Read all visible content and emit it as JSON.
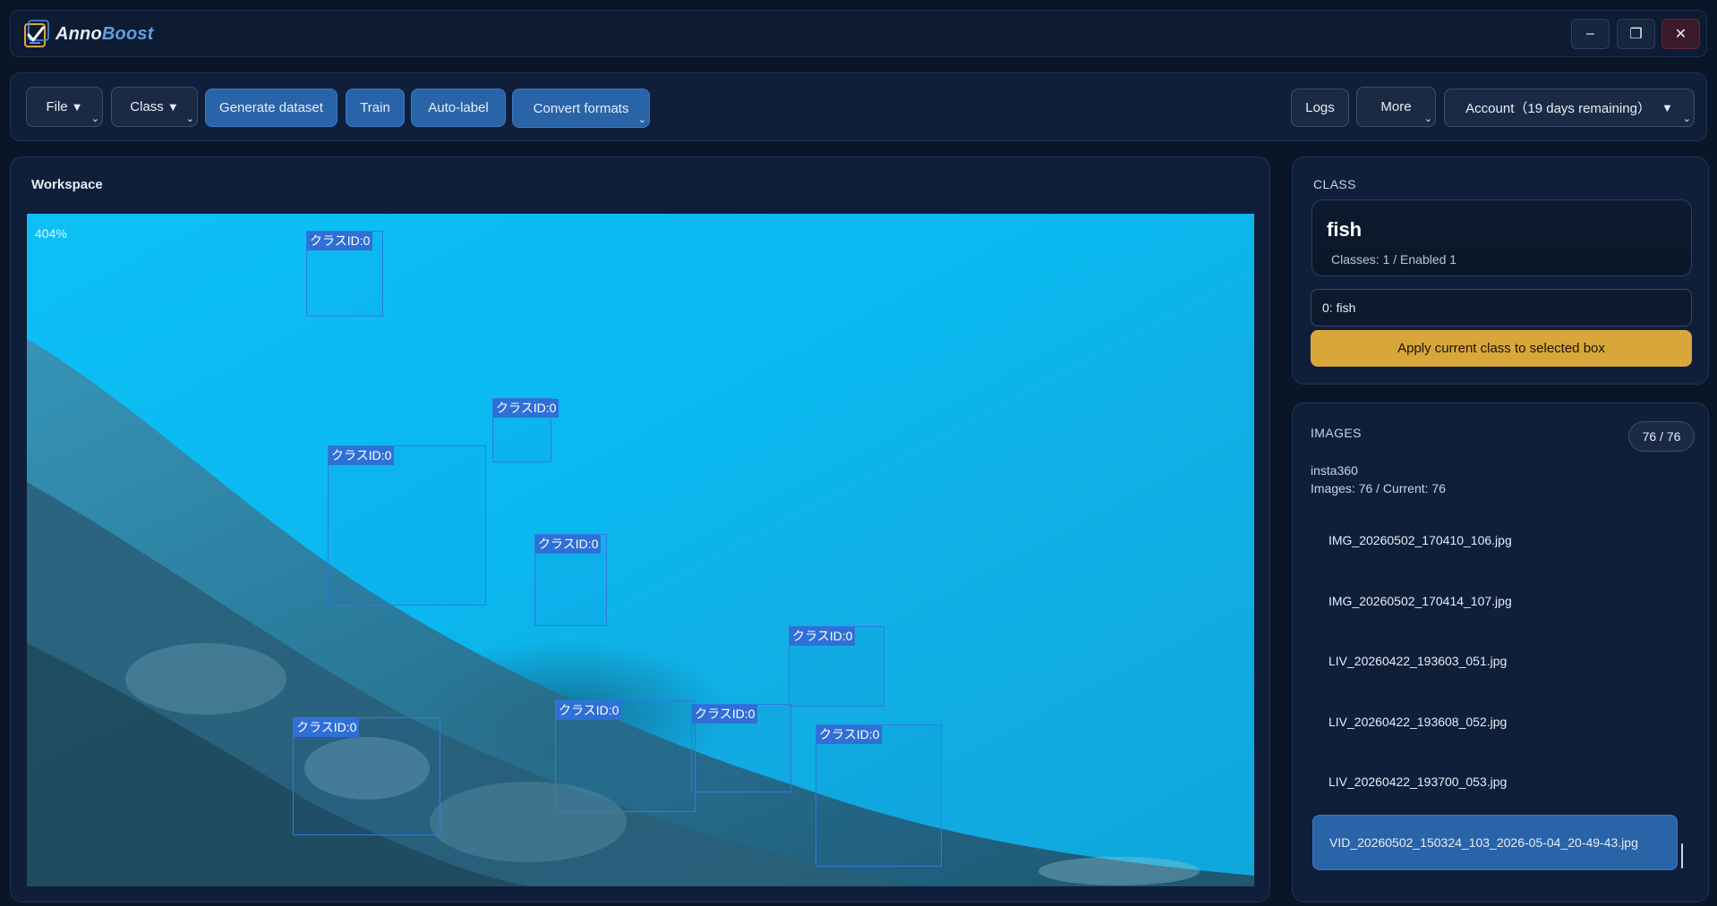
{
  "app": {
    "name_part1": "Anno",
    "name_part2": "Boost",
    "window_controls": {
      "minimize": "–",
      "restore": "❐",
      "close": "✕"
    }
  },
  "toolbar": {
    "file": "File",
    "class": "Class",
    "generate_dataset": "Generate dataset",
    "train": "Train",
    "auto_label": "Auto-label",
    "convert_formats": "Convert formats",
    "logs": "Logs",
    "more": "More",
    "account": "Account（19 days remaining）",
    "caret": "▼",
    "chevron": "⌄"
  },
  "workspace": {
    "title": "Workspace",
    "zoom": "404%",
    "boxes": [
      {
        "label": "クラスID:0"
      },
      {
        "label": "クラスID:0"
      },
      {
        "label": "クラスID:0"
      },
      {
        "label": "クラスID:0"
      },
      {
        "label": "クラスID:0"
      },
      {
        "label": "クラスID:0"
      },
      {
        "label": "クラスID:0"
      },
      {
        "label": "クラスID:0"
      },
      {
        "label": "クラスID:0"
      }
    ]
  },
  "class_panel": {
    "heading": "CLASS",
    "current_class": "fish",
    "meta": "Classes: 1 / Enabled 1",
    "selected_option": "0: fish",
    "apply_button": "Apply current class to selected box"
  },
  "images_panel": {
    "heading": "IMAGES",
    "count": "76 / 76",
    "dataset_name": "insta360",
    "dataset_meta": "Images: 76 / Current: 76",
    "files": [
      "IMG_20260502_170410_106.jpg",
      "IMG_20260502_170414_107.jpg",
      "LIV_20260422_193603_051.jpg",
      "LIV_20260422_193608_052.jpg",
      "LIV_20260422_193700_053.jpg",
      "VID_20260502_150324_103_2026-05-04_20-49-43.jpg"
    ],
    "selected_index": 5
  },
  "colors": {
    "background": "#0a1628",
    "panel": "#0f1f3a",
    "accent_blue": "#2a64a8",
    "accent_gold": "#d9a63a",
    "bbox": "#2f7ae0",
    "close_button": "#3b1b2a"
  }
}
